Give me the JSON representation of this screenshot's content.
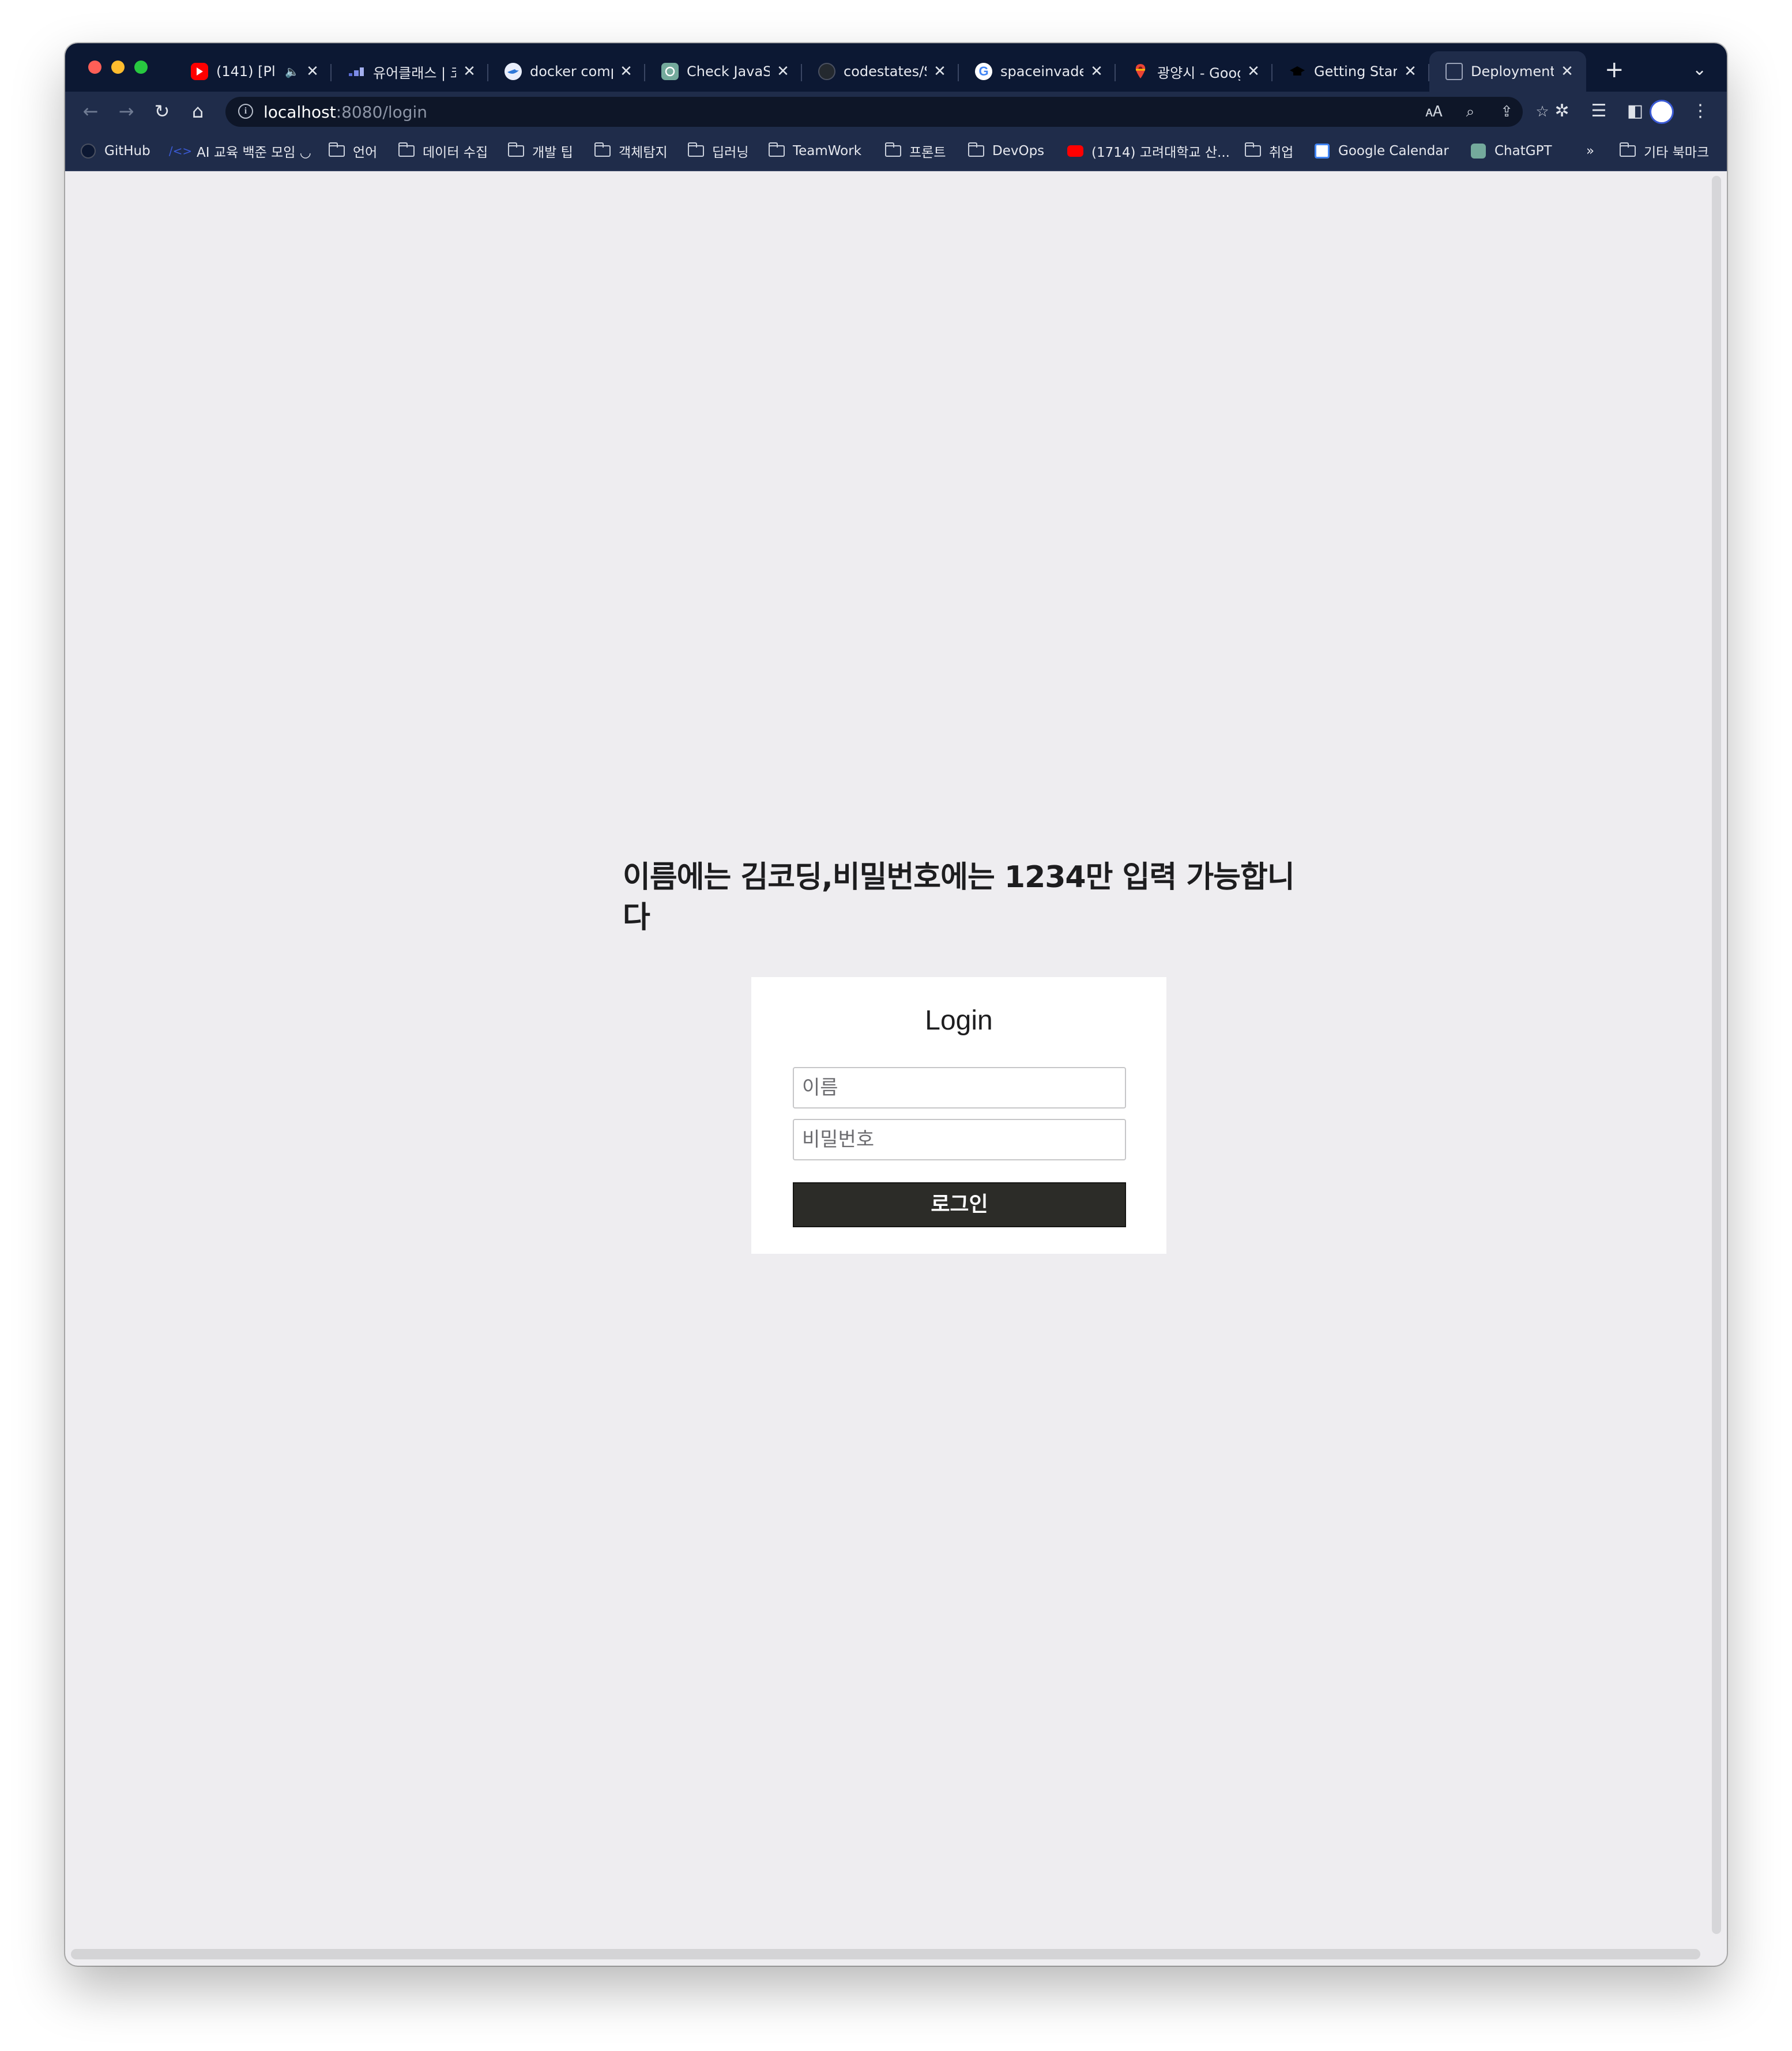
{
  "browser": {
    "tabs": [
      {
        "title": "(141) [Pl",
        "favicon": "youtube-icon",
        "color": "#ff0000",
        "muted_indicator": "🔈"
      },
      {
        "title": "유어클래스 | 코",
        "favicon": "urclass-icon",
        "color": "#5b6dd6"
      },
      {
        "title": "docker comp",
        "favicon": "docker-icon",
        "color": "#2f78d8"
      },
      {
        "title": "Check JavaS",
        "favicon": "chatgpt-icon",
        "color": "#74aa9c"
      },
      {
        "title": "codestates/S",
        "favicon": "github-icon",
        "color": "#24292f"
      },
      {
        "title": "spaceinvade",
        "favicon": "google-icon",
        "color": "#ffffff"
      },
      {
        "title": "광양시 - Goog",
        "favicon": "google-maps-icon",
        "color": "#ea4335"
      },
      {
        "title": "Getting Start",
        "favicon": "graduation-cap-icon",
        "color": "#000000"
      },
      {
        "title": "Deployment",
        "favicon": "document-icon",
        "color": "#9aa3b8",
        "active": true
      }
    ],
    "address": {
      "host": "localhost",
      "rest": ":8080/login"
    },
    "bookmarks": [
      {
        "label": "GitHub",
        "icon": "github-icon"
      },
      {
        "label": "AI 교육 백준 모임 ◡",
        "icon": "code-icon"
      },
      {
        "label": "언어",
        "icon": "folder-icon"
      },
      {
        "label": "데이터 수집",
        "icon": "folder-icon"
      },
      {
        "label": "개발 팁",
        "icon": "folder-icon"
      },
      {
        "label": "객체탐지",
        "icon": "folder-icon"
      },
      {
        "label": "딥러닝",
        "icon": "folder-icon"
      },
      {
        "label": "TeamWork",
        "icon": "folder-icon"
      },
      {
        "label": "프론트",
        "icon": "folder-icon"
      },
      {
        "label": "DevOps",
        "icon": "folder-icon"
      },
      {
        "label": "(1714) 고려대학교 산...",
        "icon": "youtube-icon"
      },
      {
        "label": "취업",
        "icon": "folder-icon"
      },
      {
        "label": "Google Calendar",
        "icon": "calendar-icon"
      },
      {
        "label": "ChatGPT",
        "icon": "chatgpt-icon"
      }
    ],
    "bookmarks_overflow": "»",
    "other_bookmarks": "기타 북마크"
  },
  "page": {
    "notice": "이름에는 김코딩,비밀번호에는 1234만 입력 가능합니다",
    "login": {
      "title": "Login",
      "name_placeholder": "이름",
      "password_placeholder": "비밀번호",
      "submit_label": "로그인"
    }
  },
  "colors": {
    "tabstrip_bg": "#0c1833",
    "toolbar_bg": "#1f2c4a",
    "page_bg": "#eeedf0",
    "button_bg": "#2c2c28"
  }
}
